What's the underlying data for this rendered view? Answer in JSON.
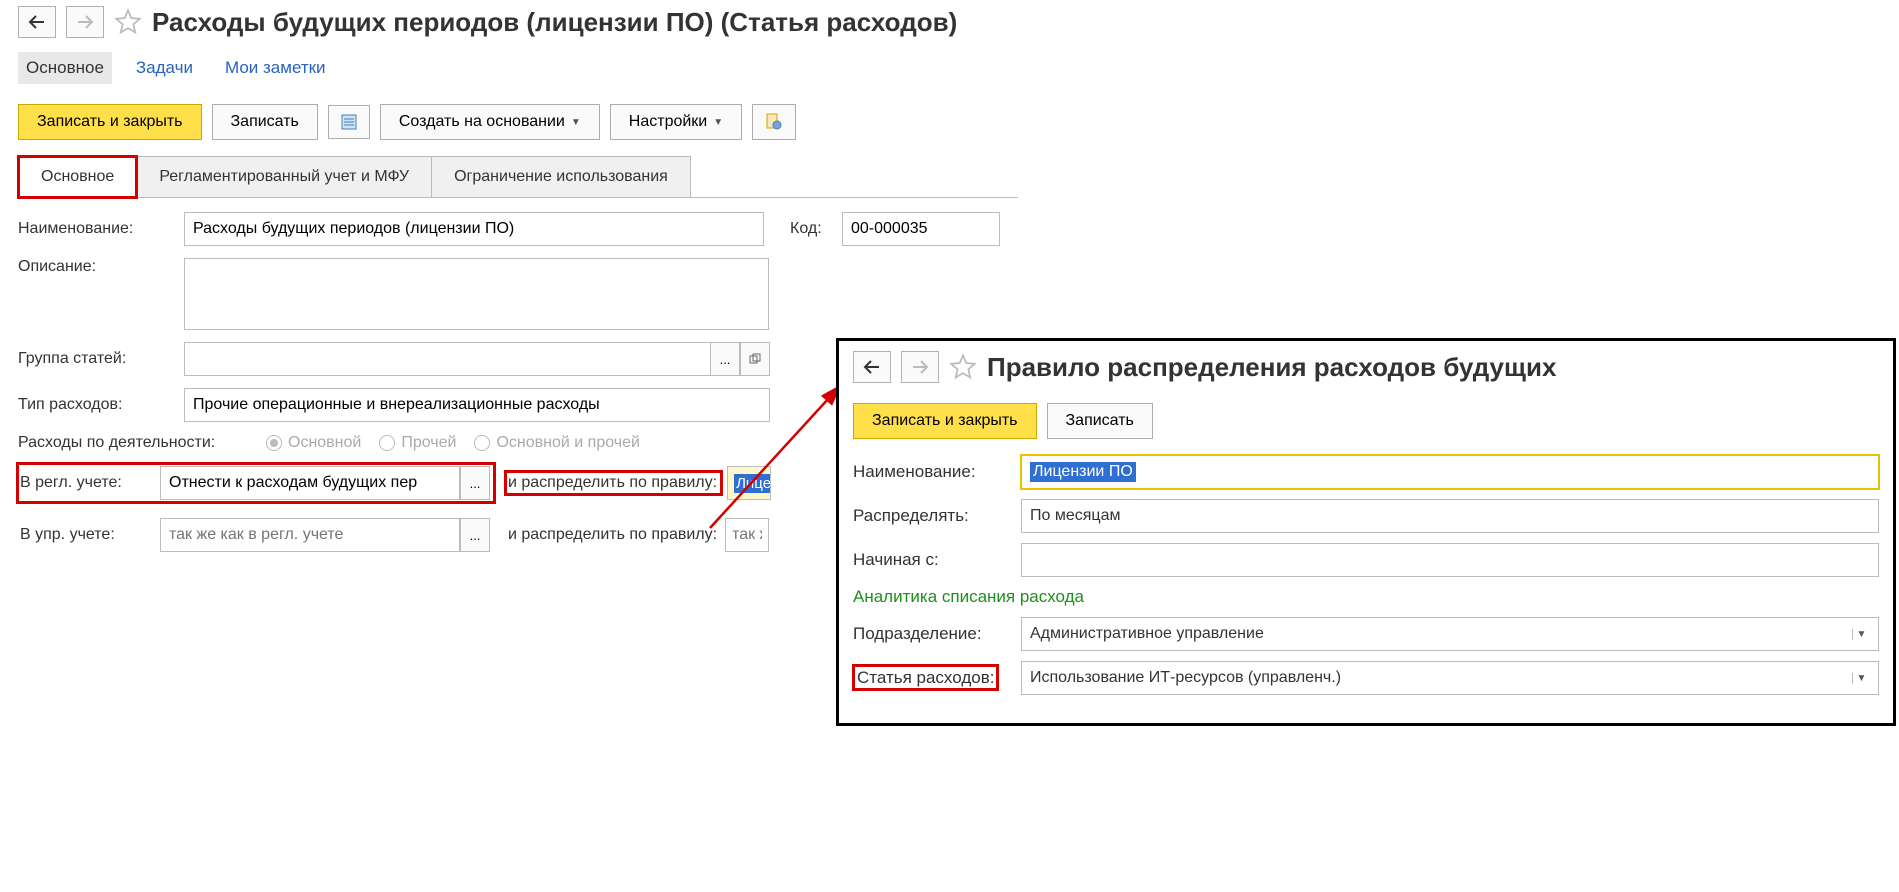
{
  "header": {
    "title": "Расходы будущих периодов (лицензии ПО) (Статья расходов)"
  },
  "topTabs": {
    "main": "Основное",
    "tasks": "Задачи",
    "notes": "Мои заметки"
  },
  "toolbar": {
    "saveClose": "Записать и закрыть",
    "save": "Записать",
    "createBased": "Создать на основании",
    "settings": "Настройки"
  },
  "formTabs": {
    "main": "Основное",
    "regAccounting": "Регламентированный учет и МФУ",
    "restriction": "Ограничение использования"
  },
  "form": {
    "nameLabel": "Наименование:",
    "nameValue": "Расходы будущих периодов (лицензии ПО)",
    "codeLabel": "Код:",
    "codeValue": "00-000035",
    "descLabel": "Описание:",
    "descValue": "",
    "groupLabel": "Группа статей:",
    "groupValue": "",
    "typeLabel": "Тип расходов:",
    "typeValue": "Прочие операционные и внереализационные расходы",
    "activityLabel": "Расходы по деятельности:",
    "radio1": "Основной",
    "radio2": "Прочей",
    "radio3": "Основной и прочей",
    "regLabel": "В регл. учете:",
    "regValue": "Отнести к расходам будущих пер",
    "ruleLabel": "и распределить по правилу:",
    "ruleValueShort": "Лице",
    "mgmtLabel": "В упр. учете:",
    "mgmtPlaceholder": "так же как в регл. учете",
    "ruleLabel2": "и распределить по правилу:",
    "rulePlaceholder2": "так ж"
  },
  "floatWindow": {
    "title": "Правило распределения расходов будущих",
    "saveClose": "Записать и закрыть",
    "save": "Записать",
    "nameLabel": "Наименование:",
    "nameValue": "Лицензии ПО",
    "distributeLabel": "Распределять:",
    "distributeValue": "По месяцам",
    "startLabel": "Начиная с:",
    "startValue": "",
    "sectionTitle": "Аналитика списания расхода",
    "deptLabel": "Подразделение:",
    "deptValue": "Административное управление",
    "expItemLabel": "Статья расходов:",
    "expItemValue": "Использование ИТ-ресурсов (управленч.)"
  }
}
